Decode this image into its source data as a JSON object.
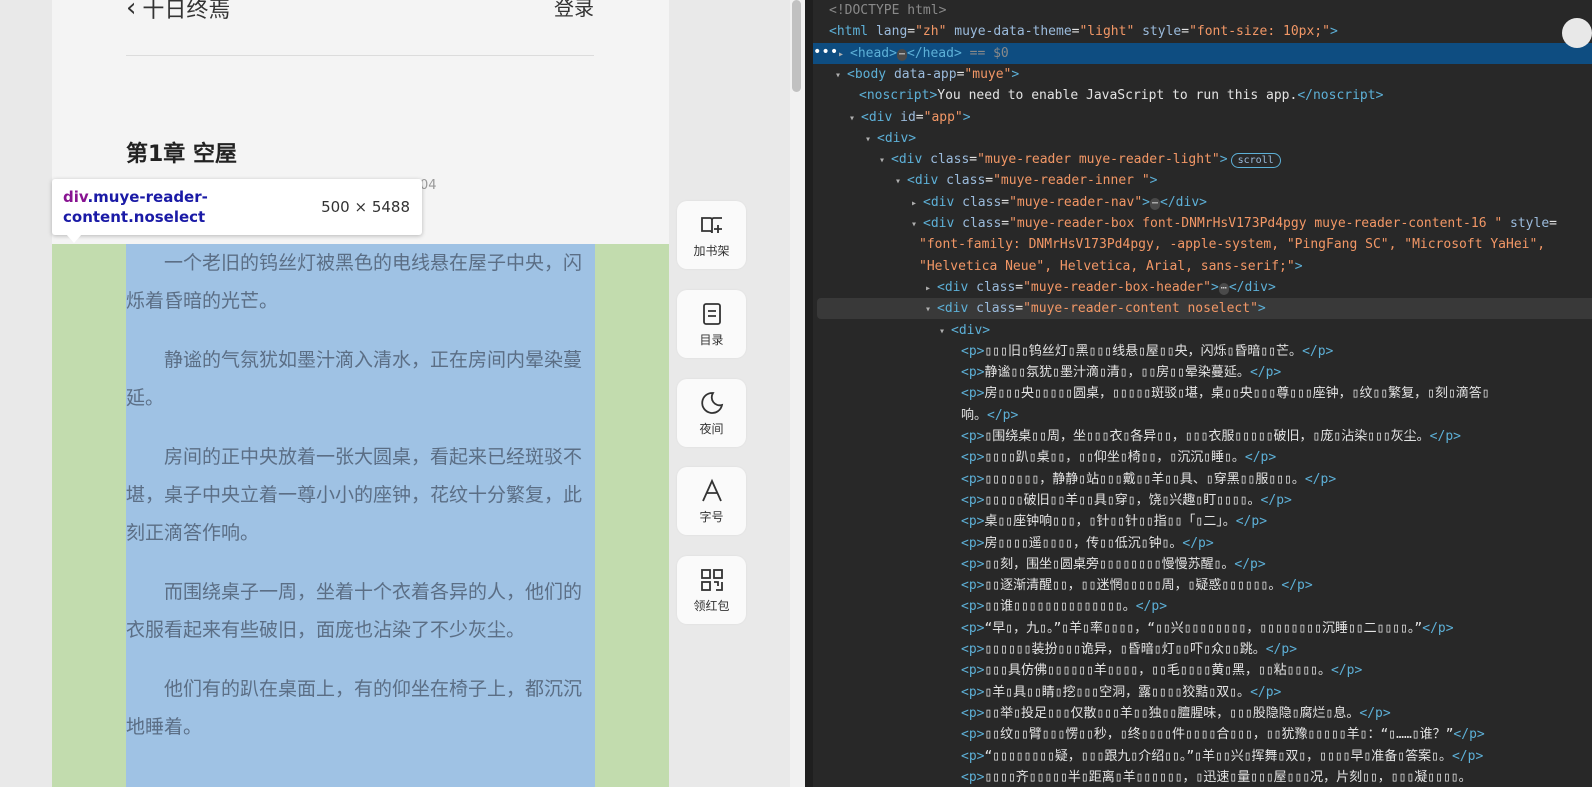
{
  "reader": {
    "back_label": "十日终焉",
    "login_label": "登录",
    "chapter_title": "第1章 空屋",
    "chapter_meta": "04",
    "paragraphs": [
      "一个老旧的钨丝灯被黑色的电线悬在屋子中央，闪烁着昏暗的光芒。",
      "静谧的气氛犹如墨汁滴入清水，正在房间内晕染蔓延。",
      "房间的正中央放着一张大圆桌，看起来已经斑驳不堪，桌子中央立着一尊小小的座钟，花纹十分繁复，此刻正滴答作响。",
      "而围绕桌子一周，坐着十个衣着各异的人，他们的衣服看起来有些破旧，面庞也沾染了不少灰尘。",
      "他们有的趴在桌面上，有的仰坐在椅子上，都沉沉地睡着。"
    ],
    "side_buttons": [
      {
        "label": "加书架",
        "icon": "bookshelf-icon"
      },
      {
        "label": "目录",
        "icon": "catalog-icon"
      },
      {
        "label": "夜间",
        "icon": "moon-icon"
      },
      {
        "label": "字号",
        "icon": "font-size-icon"
      },
      {
        "label": "领红包",
        "icon": "qr-code-icon"
      }
    ]
  },
  "inspector_tooltip": {
    "selector_tag": "div",
    "selector_class": ".muye-reader-content.noselect",
    "dimensions": "500 × 5488"
  },
  "devtools": {
    "lines": [
      {
        "indent": 0,
        "html": "<span class='cmt'>&lt;!DOCTYPE html&gt;</span>"
      },
      {
        "indent": 0,
        "html": "<span class='tag'>&lt;html</span> <span class='attr'>lang</span>=<span class='aval'>\"zh\"</span> <span class='attr'>muye-data-theme</span>=<span class='aval'>\"light\"</span> <span class='attr'>style</span>=<span class='aval'>\"font-size: 10px;\"</span><span class='tag'>&gt;</span>"
      },
      {
        "indent": 0,
        "html": "<span class='tri'>▸</span><span class='tag'>&lt;head&gt;</span><span class='dots'>⋯</span><span class='tag'>&lt;/head&gt;</span> <span class='cmt'>== $0</span>",
        "selected": true
      },
      {
        "indent": 0,
        "html": "<span class='tri'>▾</span><span class='tag'>&lt;body</span> <span class='attr'>data-app</span>=<span class='aval'>\"muye\"</span><span class='tag'>&gt;</span>"
      },
      {
        "indent": 1,
        "html": "<span class='tag'>&lt;noscript&gt;</span><span class='txt'>You need to enable JavaScript to run this app.</span><span class='tag'>&lt;/noscript&gt;</span>"
      },
      {
        "indent": 1,
        "html": "<span class='tri'>▾</span><span class='tag'>&lt;div</span> <span class='attr'>id</span>=<span class='aval'>\"app\"</span><span class='tag'>&gt;</span>"
      },
      {
        "indent": 2,
        "html": "<span class='tri'>▾</span><span class='tag'>&lt;div&gt;</span>"
      },
      {
        "indent": 3,
        "html": "<span class='tri'>▾</span><span class='tag'>&lt;div</span> <span class='attr'>class</span>=<span class='aval'>\"muye-reader muye-reader-light\"</span><span class='tag'>&gt;</span><span class='badge'>scroll</span>"
      },
      {
        "indent": 4,
        "html": "<span class='tri'>▾</span><span class='tag'>&lt;div</span> <span class='attr'>class</span>=<span class='aval'>\"muye-reader-inner \"</span><span class='tag'>&gt;</span>"
      },
      {
        "indent": 5,
        "html": "<span class='tri'>▸</span><span class='tag'>&lt;div</span> <span class='attr'>class</span>=<span class='aval'>\"muye-reader-nav\"</span><span class='tag'>&gt;</span><span class='dots'>⋯</span><span class='tag'>&lt;/div&gt;</span>"
      },
      {
        "indent": 5,
        "html": "<span class='tri'>▾</span><span class='tag'>&lt;div</span> <span class='attr'>class</span>=<span class='aval'>\"muye-reader-box font-DNMrHsV173Pd4pgy muye-reader-content-16 \"</span> <span class='attr'>style</span>="
      },
      {
        "indent": 6,
        "html": "<span class='aval'>\"font-family: DNMrHsV173Pd4pgy, -apple-system, \"PingFang SC\", \"Microsoft YaHei\",</span>"
      },
      {
        "indent": 6,
        "html": "<span class='aval'>\"Helvetica Neue\", Helvetica, Arial, sans-serif;\"</span><span class='tag'>&gt;</span>"
      },
      {
        "indent": 6,
        "html": "<span class='tri'>▸</span><span class='tag'>&lt;div</span> <span class='attr'>class</span>=<span class='aval'>\"muye-reader-box-header\"</span><span class='tag'>&gt;</span><span class='dots'>⋯</span><span class='tag'>&lt;/div&gt;</span>"
      },
      {
        "indent": 6,
        "html": "<span class='tri'>▾</span><span class='tag'>&lt;div</span> <span class='attr'>class</span>=<span class='aval'>\"muye-reader-content noselect\"</span><span class='tag'>&gt;</span>",
        "hover": true
      },
      {
        "indent": 7,
        "html": "<span class='tri'>▾</span><span class='tag'>&lt;div&gt;</span>"
      },
      {
        "indent": 8,
        "html": "<span class='tag'>&lt;p&gt;</span><span class='txt'>▯▯▯旧▯钨丝灯▯黑▯▯▯线悬▯屋▯▯央，闪烁▯昏暗▯▯芒。</span><span class='tag'>&lt;/p&gt;</span>"
      },
      {
        "indent": 8,
        "html": "<span class='tag'>&lt;p&gt;</span><span class='txt'>静谧▯▯氛犹▯墨汁滴▯清▯，▯▯房▯▯晕染蔓延。</span><span class='tag'>&lt;/p&gt;</span>"
      },
      {
        "indent": 8,
        "html": "<span class='tag'>&lt;p&gt;</span><span class='txt'>房▯▯▯央▯▯▯▯▯圆桌，▯▯▯▯▯斑驳▯堪，桌▯▯央▯▯▯尊▯▯▯座钟，▯纹▯▯繁复，▯刻▯滴答▯</span>"
      },
      {
        "indent": 8,
        "html": "<span class='txt'>响。</span><span class='tag'>&lt;/p&gt;</span>"
      },
      {
        "indent": 8,
        "html": "<span class='tag'>&lt;p&gt;</span><span class='txt'>▯围绕桌▯▯周，坐▯▯▯衣▯各异▯▯，▯▯▯衣服▯▯▯▯▯破旧，▯庞▯沾染▯▯▯灰尘。</span><span class='tag'>&lt;/p&gt;</span>"
      },
      {
        "indent": 8,
        "html": "<span class='tag'>&lt;p&gt;</span><span class='txt'>▯▯▯▯趴▯桌▯▯，▯▯仰坐▯椅▯▯，▯沉沉▯睡▯。</span><span class='tag'>&lt;/p&gt;</span>"
      },
      {
        "indent": 8,
        "html": "<span class='tag'>&lt;p&gt;</span><span class='txt'>▯▯▯▯▯▯▯，静静▯站▯▯▯戴▯▯羊▯▯具、▯穿黑▯▯服▯▯▯。</span><span class='tag'>&lt;/p&gt;</span>"
      },
      {
        "indent": 8,
        "html": "<span class='tag'>&lt;p&gt;</span><span class='txt'>▯▯▯▯▯破旧▯▯羊▯▯具▯穿▯，饶▯兴趣▯盯▯▯▯▯。</span><span class='tag'>&lt;/p&gt;</span>"
      },
      {
        "indent": 8,
        "html": "<span class='tag'>&lt;p&gt;</span><span class='txt'>桌▯▯座钟响▯▯▯，▯针▯▯针▯▯指▯▯「▯二」。</span><span class='tag'>&lt;/p&gt;</span>"
      },
      {
        "indent": 8,
        "html": "<span class='tag'>&lt;p&gt;</span><span class='txt'>房▯▯▯▯遥▯▯▯▯，传▯▯低沉▯钟▯。</span><span class='tag'>&lt;/p&gt;</span>"
      },
      {
        "indent": 8,
        "html": "<span class='tag'>&lt;p&gt;</span><span class='txt'>▯▯刻，围坐▯圆桌旁▯▯▯▯▯▯▯▯慢慢苏醒▯。</span><span class='tag'>&lt;/p&gt;</span>"
      },
      {
        "indent": 8,
        "html": "<span class='tag'>&lt;p&gt;</span><span class='txt'>▯▯逐渐清醒▯▯，▯▯迷惘▯▯▯▯▯周，▯疑惑▯▯▯▯▯▯。</span><span class='tag'>&lt;/p&gt;</span>"
      },
      {
        "indent": 8,
        "html": "<span class='tag'>&lt;p&gt;</span><span class='txt'>▯▯谁▯▯▯▯▯▯▯▯▯▯▯▯▯▯。</span><span class='tag'>&lt;/p&gt;</span>"
      },
      {
        "indent": 8,
        "html": "<span class='tag'>&lt;p&gt;</span><span class='txt'>“早▯，九▯。”▯羊▯率▯▯▯▯，“▯▯兴▯▯▯▯▯▯▯▯，▯▯▯▯▯▯▯▯沉睡▯▯二▯▯▯▯。”</span><span class='tag'>&lt;/p&gt;</span>"
      },
      {
        "indent": 8,
        "html": "<span class='tag'>&lt;p&gt;</span><span class='txt'>▯▯▯▯▯▯装扮▯▯▯诡异，▯昏暗▯灯▯▯吓▯众▯▯跳。</span><span class='tag'>&lt;/p&gt;</span>"
      },
      {
        "indent": 8,
        "html": "<span class='tag'>&lt;p&gt;</span><span class='txt'>▯▯▯具仿佛▯▯▯▯▯▯羊▯▯▯▯，▯▯毛▯▯▯▯黄▯黑，▯▯粘▯▯▯▯。</span><span class='tag'>&lt;/p&gt;</span>"
      },
      {
        "indent": 8,
        "html": "<span class='tag'>&lt;p&gt;</span><span class='txt'>▯羊▯具▯▯睛▯挖▯▯▯空洞，露▯▯▯▯狡黠▯双▯。</span><span class='tag'>&lt;/p&gt;</span>"
      },
      {
        "indent": 8,
        "html": "<span class='tag'>&lt;p&gt;</span><span class='txt'>▯▯举▯投足▯▯▯仅散▯▯▯羊▯▯独▯▯膻腥味，▯▯▯股隐隐▯腐烂▯息。</span><span class='tag'>&lt;/p&gt;</span>"
      },
      {
        "indent": 8,
        "html": "<span class='tag'>&lt;p&gt;</span><span class='txt'>▯▯纹▯▯臂▯▯▯愣▯▯秒，▯终▯▯▯▯件▯▯▯▯合▯▯▯，▯▯犹豫▯▯▯▯▯羊▯：“▯……▯谁？”</span><span class='tag'>&lt;/p&gt;</span>"
      },
      {
        "indent": 8,
        "html": "<span class='tag'>&lt;p&gt;</span><span class='txt'>“▯▯▯▯▯▯▯▯疑，▯▯▯跟九▯介绍▯▯。”▯羊▯▯兴▯挥舞▯双▯，▯▯▯▯早▯准备▯答案▯。</span><span class='tag'>&lt;/p&gt;</span>"
      },
      {
        "indent": 8,
        "html": "<span class='tag'>&lt;p&gt;</span><span class='txt'>▯▯▯▯齐▯▯▯▯▯半▯距离▯羊▯▯▯▯▯▯，▯迅速▯量▯▯▯屋▯▯▯况，片刻▯▯，▯▯▯凝▯▯▯▯。</span>"
      }
    ]
  }
}
